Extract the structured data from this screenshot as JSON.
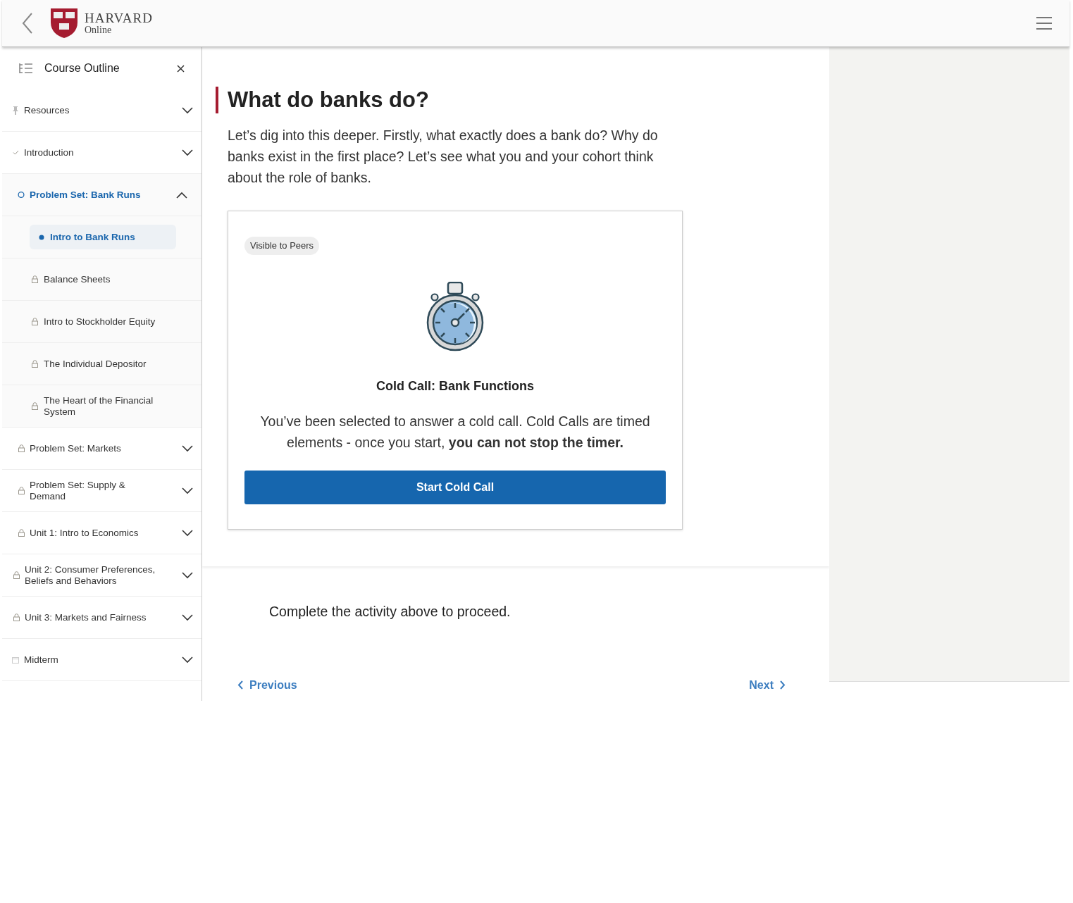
{
  "header": {
    "brand_name": "HARVARD",
    "brand_sub": "Online"
  },
  "sidebar": {
    "title": "Course Outline",
    "items": [
      {
        "label": "Resources",
        "kind": "pin",
        "selected": false,
        "expanded": false
      },
      {
        "label": "Introduction",
        "kind": "check",
        "selected": false,
        "expanded": false
      },
      {
        "label": "Problem Set: Bank Runs",
        "kind": "circle",
        "selected": true,
        "expanded": true,
        "children": [
          {
            "label": "Intro to Bank Runs",
            "kind": "dot",
            "selected": true
          },
          {
            "label": "Balance Sheets",
            "kind": "lock",
            "selected": false
          },
          {
            "label": "Intro to Stockholder Equity",
            "kind": "lock",
            "selected": false
          },
          {
            "label": "The Individual Depositor",
            "kind": "lock",
            "selected": false
          },
          {
            "label": "The Heart of the Financial System",
            "kind": "lock",
            "selected": false
          }
        ]
      },
      {
        "label": "Problem Set: Markets",
        "kind": "lock",
        "selected": false,
        "expanded": false
      },
      {
        "label": "Problem Set: Supply & Demand",
        "kind": "lock",
        "selected": false,
        "expanded": false
      },
      {
        "label": "Unit 1: Intro to Economics",
        "kind": "lock",
        "selected": false,
        "expanded": false
      },
      {
        "label": "Unit 2: Consumer Preferences, Beliefs and Behaviors",
        "kind": "lock",
        "selected": false,
        "expanded": false
      },
      {
        "label": "Unit 3: Markets and Fairness",
        "kind": "lock",
        "selected": false,
        "expanded": false
      },
      {
        "label": "Midterm",
        "kind": "calendar",
        "selected": false,
        "expanded": false
      }
    ]
  },
  "content": {
    "heading": "What do banks do?",
    "intro": "Let’s dig into this deeper. Firstly, what exactly does a bank do? Why do banks exist in the first place? Let’s see what you and your cohort think about the role of banks.",
    "card": {
      "badge": "Visible to Peers",
      "title": "Cold Call: Bank Functions",
      "body": "You’ve been selected to answer a cold call. Cold Calls are timed elements - once you start, **you can not stop the timer.**",
      "button": "Start Cold Call"
    },
    "footer": {
      "message": "Complete the activity above to proceed.",
      "previous": "Previous",
      "next": "Next"
    }
  }
}
